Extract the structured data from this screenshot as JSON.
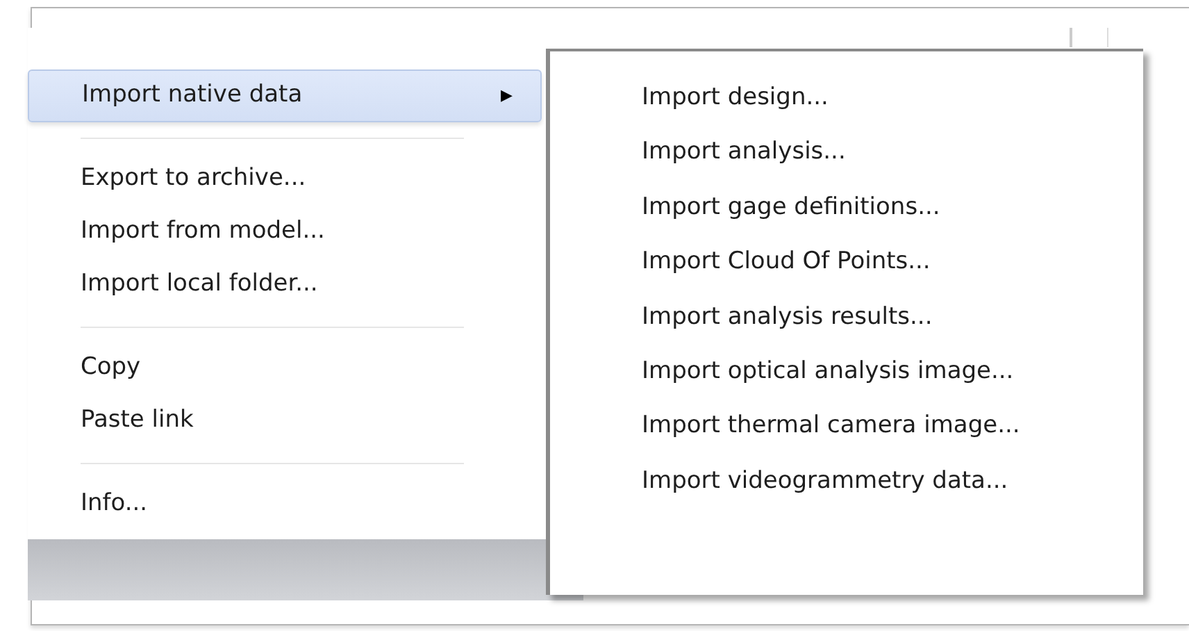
{
  "context_menu": {
    "items": [
      {
        "kind": "item",
        "label": "Import native data",
        "selected": true,
        "submenu_arrow": "▶"
      },
      {
        "kind": "separator"
      },
      {
        "kind": "item",
        "label": "Export to archive...",
        "selected": false
      },
      {
        "kind": "item",
        "label": "Import from model...",
        "selected": false
      },
      {
        "kind": "item",
        "label": "Import local folder...",
        "selected": false
      },
      {
        "kind": "separator"
      },
      {
        "kind": "item",
        "label": "Copy",
        "selected": false
      },
      {
        "kind": "item",
        "label": "Paste link",
        "selected": false
      },
      {
        "kind": "separator"
      },
      {
        "kind": "item",
        "label": "Info...",
        "selected": false
      }
    ]
  },
  "submenu": {
    "items": [
      {
        "label": "Import design..."
      },
      {
        "label": "Import analysis..."
      },
      {
        "label": "Import gage definitions..."
      },
      {
        "label": "Import Cloud Of Points..."
      },
      {
        "label": "Import analysis results..."
      },
      {
        "label": "Import optical analysis image..."
      },
      {
        "label": "Import thermal camera image..."
      },
      {
        "label": "Import videogrammetry data..."
      }
    ]
  }
}
